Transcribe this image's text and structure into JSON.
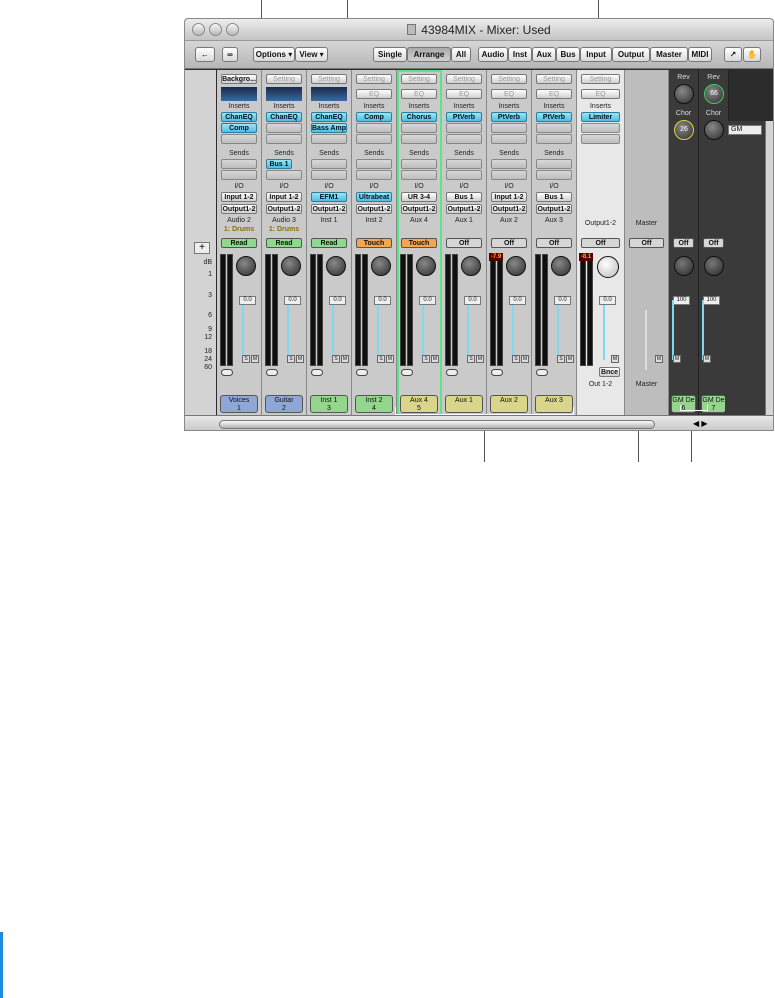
{
  "window": {
    "title": "43984MIX - Mixer: Used"
  },
  "toolbar": {
    "options": "Options",
    "view": "View",
    "views": [
      "Single",
      "Arrange",
      "All"
    ],
    "filters": [
      "Audio",
      "Inst",
      "Aux",
      "Bus",
      "Input",
      "Output",
      "Master",
      "MIDI"
    ]
  },
  "ruler": {
    "unit": "dB",
    "ticks": [
      "1",
      "3",
      "6",
      "9",
      "12",
      "18",
      "24",
      "60"
    ]
  },
  "channels": [
    {
      "setting": "Backgro...",
      "inserts": [
        "ChanEQ",
        "Comp"
      ],
      "sends": [],
      "input": "Input 1-2",
      "output": "Output1-2",
      "track": "Audio 2",
      "group": "1: Drums",
      "automation": "Read",
      "auto_color": "#8fd98f",
      "volume": "0.0",
      "name": "Voices",
      "number": "1",
      "name_color": "#8fa7d6"
    },
    {
      "setting": "Setting",
      "inserts": [
        "ChanEQ"
      ],
      "sends": [
        "Bus 1"
      ],
      "input": "Input 1-2",
      "output": "Output1-2",
      "track": "Audio 3",
      "group": "1: Drums",
      "automation": "Read",
      "auto_color": "#8fd98f",
      "volume": "0.0",
      "name": "Guitar",
      "number": "2",
      "name_color": "#8fa7d6"
    },
    {
      "setting": "Setting",
      "inserts": [
        "ChanEQ",
        "Bass Amp"
      ],
      "sends": [],
      "input": "EFM1",
      "output": "Output1-2",
      "track": "Inst 1",
      "group": "",
      "automation": "Read",
      "auto_color": "#8fd98f",
      "volume": "0.0",
      "name": "Inst 1",
      "number": "3",
      "name_color": "#93d68c"
    },
    {
      "setting": "Setting",
      "inserts": [
        "Comp"
      ],
      "sends": [],
      "input": "Ultrabeat",
      "output": "Output1-2",
      "track": "Inst 2",
      "group": "",
      "automation": "Touch",
      "auto_color": "#f2a64f",
      "volume": "0.0",
      "name": "Inst 2",
      "number": "4",
      "name_color": "#93d68c"
    },
    {
      "setting": "Setting",
      "inserts": [
        "Chorus"
      ],
      "sends": [],
      "input": "UR 3-4",
      "output": "Output1-2",
      "track": "Aux 4",
      "group": "",
      "automation": "Touch",
      "auto_color": "#f2a64f",
      "volume": "0.0",
      "name": "Aux 4",
      "number": "5",
      "name_color": "#d9d58b"
    },
    {
      "setting": "Setting",
      "inserts": [
        "PtVerb"
      ],
      "sends": [],
      "input": "Bus 1",
      "output": "Output1-2",
      "track": "Aux 1",
      "group": "",
      "automation": "Off",
      "auto_color": "#d6d6d6",
      "volume": "0.0",
      "name": "Aux 1",
      "number": "",
      "name_color": "#d9d58b"
    },
    {
      "setting": "Setting",
      "inserts": [
        "PtVerb"
      ],
      "sends": [],
      "input": "Input 1-2",
      "output": "Output1-2",
      "track": "Aux 2",
      "group": "",
      "automation": "Off",
      "auto_color": "#d6d6d6",
      "volume": "0.0",
      "name": "Aux 2",
      "number": "",
      "name_color": "#d9d58b",
      "peak": "-7.9"
    },
    {
      "setting": "Setting",
      "inserts": [
        "PtVerb"
      ],
      "sends": [],
      "input": "Bus 1",
      "output": "Output1-2",
      "track": "Aux 3",
      "group": "",
      "automation": "Off",
      "auto_color": "#d6d6d6",
      "volume": "0.0",
      "name": "Aux 3",
      "number": "",
      "name_color": "#d9d58b"
    }
  ],
  "output_strip": {
    "setting": "Setting",
    "eq": "EQ",
    "inserts": [
      "Limiter"
    ],
    "output": "Output1-2",
    "automation": "Off",
    "volume": "0.0",
    "peak": "-8.1",
    "bnce": "Bnce",
    "name": "Out 1-2"
  },
  "master_strip": {
    "track": "Master",
    "automation": "Off",
    "name": "Master"
  },
  "gm_strips": [
    {
      "knob_top": "Rev",
      "knob_top_value": "",
      "knob_bottom": "Chor",
      "knob_bottom_value": "26",
      "automation": "Off",
      "volume": "100",
      "name": "GM De",
      "number": "6"
    },
    {
      "knob_top": "Rev",
      "knob_top_value": "66",
      "knob_bottom": "Chor",
      "knob_bottom_value": "",
      "automation": "Off",
      "volume": "100",
      "name": "GM De",
      "number": "7"
    }
  ],
  "right_panel": {
    "label": "GM"
  },
  "labels": {
    "inserts": "Inserts",
    "sends": "Sends",
    "io": "I/O",
    "eq": "EQ"
  }
}
